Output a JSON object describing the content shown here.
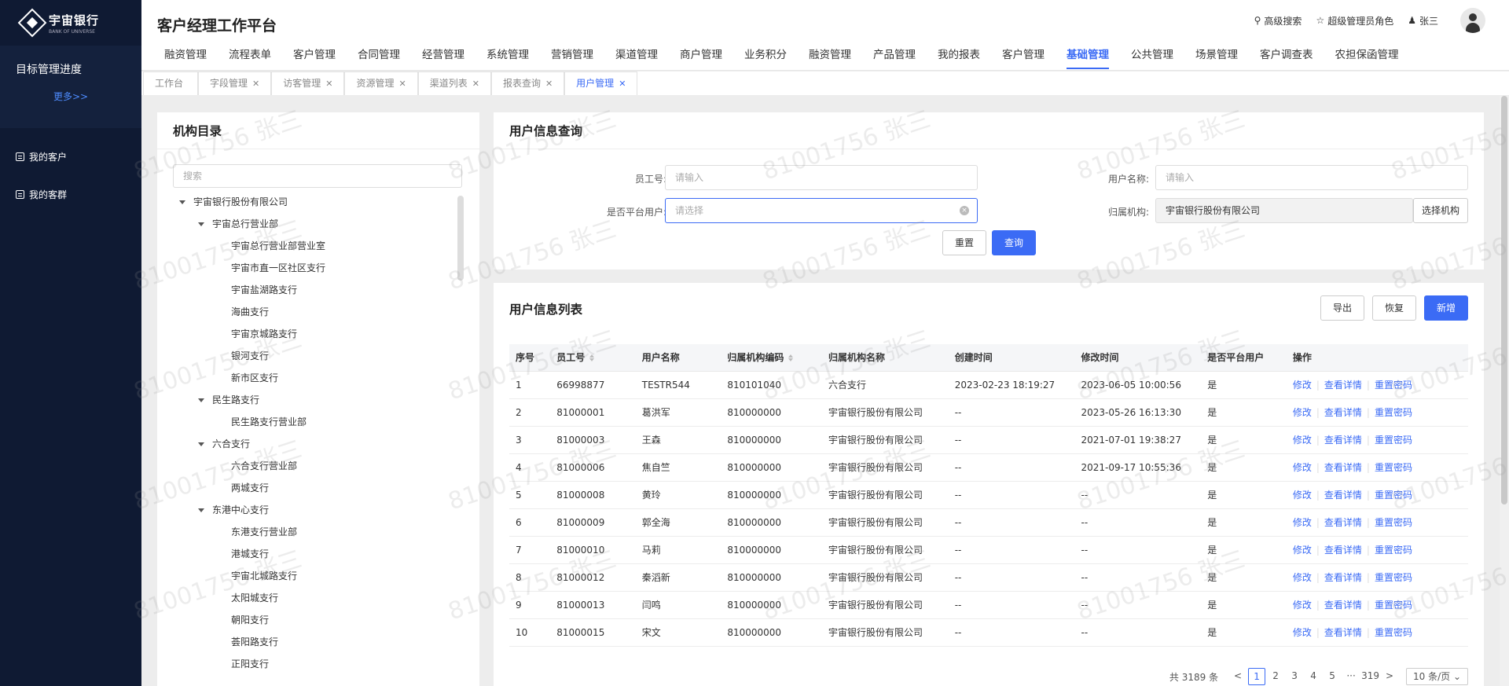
{
  "sidebar": {
    "logo_cn": "宇宙银行",
    "logo_en": "BANK OF UNIVERSE",
    "goal_title": "目标管理进度",
    "goal_more": "更多>>",
    "items": [
      {
        "label": "我的客户",
        "icon": "customer-icon"
      },
      {
        "label": "我的客群",
        "icon": "group-icon"
      }
    ]
  },
  "header": {
    "title": "客户经理工作平台",
    "advanced_search": "高级搜索",
    "role": "超级管理员角色",
    "user": "张三",
    "nav": [
      "融资管理",
      "流程表单",
      "客户管理",
      "合同管理",
      "经营管理",
      "系统管理",
      "营销管理",
      "渠道管理",
      "商户管理",
      "业务积分",
      "融资管理",
      "产品管理",
      "我的报表",
      "客户管理",
      "基础管理",
      "公共管理",
      "场景管理",
      "客户调查表",
      "农担保函管理"
    ],
    "active_nav": "基础管理"
  },
  "tabs": [
    {
      "label": "工作台",
      "closable": false
    },
    {
      "label": "字段管理",
      "closable": true
    },
    {
      "label": "访客管理",
      "closable": true
    },
    {
      "label": "资源管理",
      "closable": true
    },
    {
      "label": "渠道列表",
      "closable": true
    },
    {
      "label": "报表查询",
      "closable": true
    },
    {
      "label": "用户管理",
      "closable": true,
      "active": true
    }
  ],
  "tree": {
    "title": "机构目录",
    "search_placeholder": "搜索",
    "nodes": [
      {
        "label": "宇宙银行股份有限公司",
        "level": 0,
        "expanded": true
      },
      {
        "label": "宇宙总行营业部",
        "level": 1,
        "expanded": true
      },
      {
        "label": "宇宙总行营业部营业室",
        "level": 2
      },
      {
        "label": "宇宙市直一区社区支行",
        "level": 2
      },
      {
        "label": "宇宙盐湖路支行",
        "level": 2
      },
      {
        "label": "海曲支行",
        "level": 2
      },
      {
        "label": "宇宙京城路支行",
        "level": 2
      },
      {
        "label": "银河支行",
        "level": 2
      },
      {
        "label": "新市区支行",
        "level": 2
      },
      {
        "label": "民生路支行",
        "level": 1,
        "expanded": true
      },
      {
        "label": "民生路支行营业部",
        "level": 2
      },
      {
        "label": "六合支行",
        "level": 1,
        "expanded": true
      },
      {
        "label": "六合支行营业部",
        "level": 2
      },
      {
        "label": "两城支行",
        "level": 2
      },
      {
        "label": "东港中心支行",
        "level": 1,
        "expanded": true
      },
      {
        "label": "东港支行营业部",
        "level": 2
      },
      {
        "label": "港城支行",
        "level": 2
      },
      {
        "label": "宇宙北城路支行",
        "level": 2
      },
      {
        "label": "太阳城支行",
        "level": 2
      },
      {
        "label": "朝阳支行",
        "level": 2
      },
      {
        "label": "荟阳路支行",
        "level": 2
      },
      {
        "label": "正阳支行",
        "level": 2
      }
    ]
  },
  "query": {
    "title": "用户信息查询",
    "employee_id_label": "员工号:",
    "employee_id_placeholder": "请输入",
    "username_label": "用户名称:",
    "username_placeholder": "请输入",
    "is_platform_label": "是否平台用户:",
    "is_platform_placeholder": "请选择",
    "org_label": "归属机构:",
    "org_value": "宇宙银行股份有限公司",
    "select_org": "选择机构",
    "reset": "重置",
    "search": "查询"
  },
  "list": {
    "title": "用户信息列表",
    "export": "导出",
    "restore": "恢复",
    "add": "新增",
    "columns": [
      "序号",
      "员工号",
      "用户名称",
      "归属机构编码",
      "归属机构名称",
      "创建时间",
      "修改时间",
      "是否平台用户",
      "操作"
    ],
    "actions": [
      "修改",
      "查看详情",
      "重置密码"
    ],
    "rows": [
      [
        "1",
        "66998877",
        "TESTR544",
        "810101040",
        "六合支行",
        "2023-02-23 18:19:27",
        "2023-06-05 10:00:56",
        "是"
      ],
      [
        "2",
        "81000001",
        "葛洪军",
        "810000000",
        "宇宙银行股份有限公司",
        "--",
        "2023-05-26 16:13:30",
        "是"
      ],
      [
        "3",
        "81000003",
        "王森",
        "810000000",
        "宇宙银行股份有限公司",
        "--",
        "2021-07-01 19:38:27",
        "是"
      ],
      [
        "4",
        "81000006",
        "焦自竺",
        "810000000",
        "宇宙银行股份有限公司",
        "--",
        "2021-09-17 10:55:36",
        "是"
      ],
      [
        "5",
        "81000008",
        "黄玲",
        "810000000",
        "宇宙银行股份有限公司",
        "--",
        "--",
        "是"
      ],
      [
        "6",
        "81000009",
        "郭全海",
        "810000000",
        "宇宙银行股份有限公司",
        "--",
        "--",
        "是"
      ],
      [
        "7",
        "81000010",
        "马莉",
        "810000000",
        "宇宙银行股份有限公司",
        "--",
        "--",
        "是"
      ],
      [
        "8",
        "81000012",
        "秦滔新",
        "810000000",
        "宇宙银行股份有限公司",
        "--",
        "--",
        "是"
      ],
      [
        "9",
        "81000013",
        "闫鸣",
        "810000000",
        "宇宙银行股份有限公司",
        "--",
        "--",
        "是"
      ],
      [
        "10",
        "81000015",
        "宋文",
        "810000000",
        "宇宙银行股份有限公司",
        "--",
        "--",
        "是"
      ]
    ]
  },
  "pager": {
    "total": "共 3189 条",
    "pages": [
      "1",
      "2",
      "3",
      "4",
      "5",
      "···",
      "319"
    ],
    "current": "1",
    "prev": "<",
    "next": ">",
    "page_size": "10 条/页"
  },
  "watermark": "81001756 张三",
  "colors": {
    "accent": "#3b6bf5",
    "sidebar_bg": "#0f1a33"
  }
}
